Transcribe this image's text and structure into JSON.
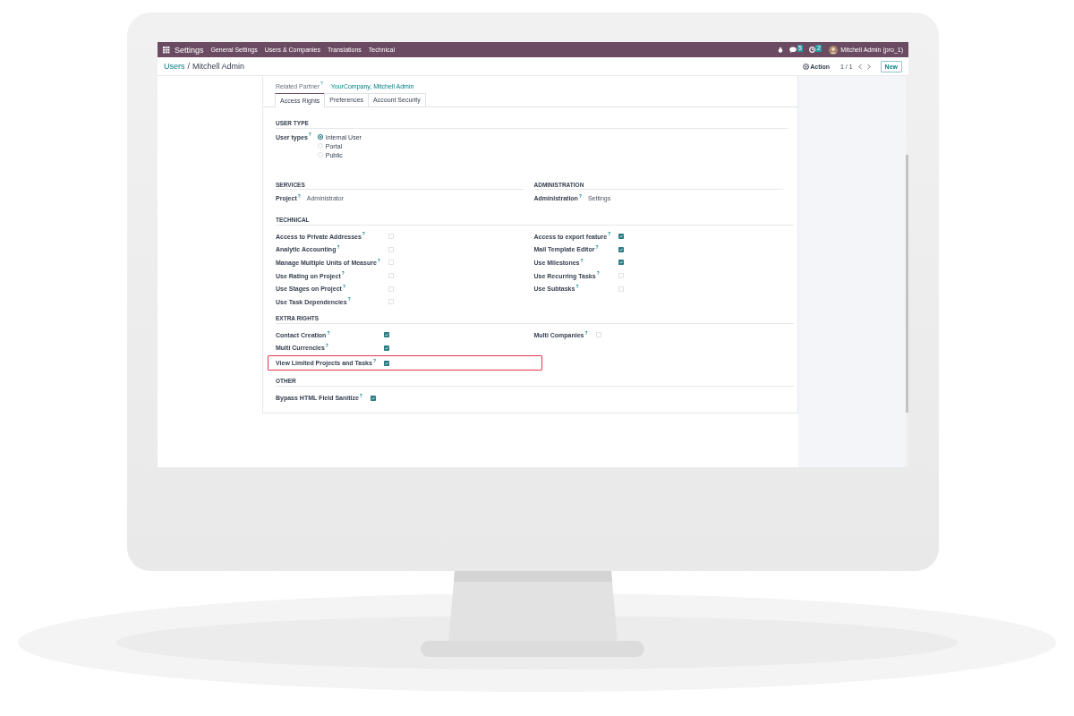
{
  "navbar": {
    "app": "Settings",
    "menus": [
      "General Settings",
      "Users & Companies",
      "Translations",
      "Technical"
    ],
    "messages_count": "5",
    "activities_count": "2",
    "user": "Mitchell Admin (pro_1)"
  },
  "control_panel": {
    "parent": "Users",
    "separator": "/",
    "current": "Mitchell Admin",
    "action": "Action",
    "pager": "1 / 1",
    "new_button": "New"
  },
  "form": {
    "related_partner": {
      "label": "Related Partner$^{?}$",
      "value": "YourCompany, Mitchell Admin"
    },
    "tabs": [
      {
        "label": "Access Rights",
        "selected": true
      },
      {
        "label": "Preferences",
        "selected": false
      },
      {
        "label": "Account Security",
        "selected": false
      }
    ],
    "sections": [
      {
        "kind": "radio",
        "title": "USER TYPE",
        "label": "User types$^{?}$",
        "options": [
          {
            "label": "Internal User",
            "selected": true
          },
          {
            "label": "Portal",
            "selected": false
          },
          {
            "label": "Public",
            "selected": false
          }
        ]
      },
      {
        "kind": "fields",
        "columns": [
          {
            "title": "SERVICES",
            "fields": [
              {
                "label": "Project$^{?}$",
                "value": "Administrator"
              }
            ]
          },
          {
            "title": "ADMINISTRATION",
            "fields": [
              {
                "label": "Administration$^{?}$",
                "value": "Settings"
              }
            ]
          }
        ]
      },
      {
        "kind": "checks",
        "title": "TECHNICAL",
        "columns": [
          {
            "items": [
              {
                "label": "Access to Private Addresses$^{?}$",
                "checked": false
              },
              {
                "label": "Analytic Accounting$^{?}$",
                "checked": false
              },
              {
                "label": "Manage Multiple Units of Measure$^{?}$",
                "checked": false
              },
              {
                "label": "Use Rating on Project$^{?}$",
                "checked": false
              },
              {
                "label": "Use Stages on Project$^{?}$",
                "checked": false
              },
              {
                "label": "Use Task Dependencies$^{?}$",
                "checked": false
              }
            ]
          },
          {
            "items": [
              {
                "label": "Access to export feature$^{?}$",
                "checked": true
              },
              {
                "label": "Mail Template Editor$^{?}$",
                "checked": true
              },
              {
                "label": "Use Milestones$^{?}$",
                "checked": true
              },
              {
                "label": "Use Recurring Tasks$^{?}$",
                "checked": false
              },
              {
                "label": "Use Subtasks$^{?}$",
                "checked": false
              }
            ]
          }
        ]
      },
      {
        "kind": "checks",
        "title": "EXTRA RIGHTS",
        "columns": [
          {
            "items": [
              {
                "label": "Contact Creation$^{?}$",
                "checked": true
              },
              {
                "label": "Multi Currencies$^{?}$",
                "checked": true
              },
              {
                "label": "View Limited Projects and Tasks$^{?}$",
                "checked": true,
                "highlighted": true
              }
            ]
          },
          {
            "items": [
              {
                "label": "Multi Companies$^{?}$",
                "checked": false
              }
            ]
          }
        ]
      },
      {
        "kind": "checks",
        "title": "OTHER",
        "columns": [
          {
            "items": [
              {
                "label": "Bypass HTML Field Sanitize$^{?}$",
                "checked": true
              }
            ]
          }
        ]
      }
    ]
  }
}
